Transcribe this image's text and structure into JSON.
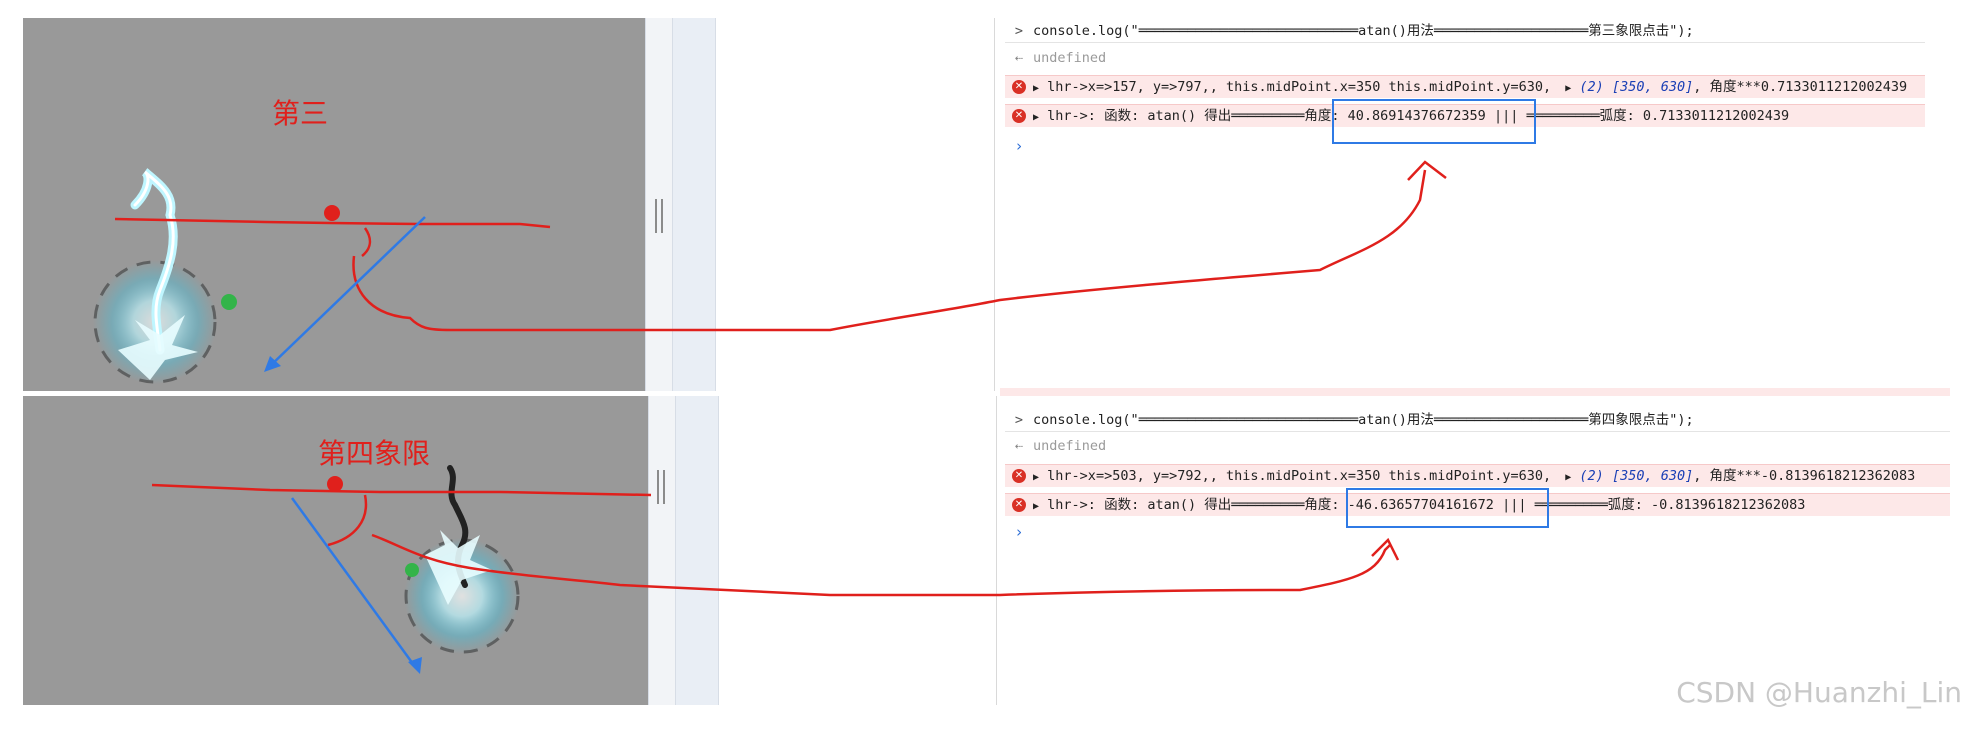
{
  "panel_top": {
    "quadrant_label": "第三",
    "console": {
      "command": "console.log(\"═══════════════════════════atan()用法═══════════════════第三象限点击\");",
      "result": "undefined",
      "log1": {
        "prefix": "lhr->x=>157, y=>797,, this.midPoint.x=350 this.midPoint.y=630,",
        "array_count": "(2)",
        "array_values": "[350, 630]",
        "suffix": ", 角度***0.7133011212002439"
      },
      "log2": {
        "prefix": "lhr->: 函数: atan() 得出═════════",
        "angle": "角度: 40.86914376672359",
        "middle": " ||| ═════════",
        "radian": "弧度: 0.7133011212002439"
      }
    }
  },
  "panel_bottom": {
    "quadrant_label": "第四象限",
    "console": {
      "command": "console.log(\"═══════════════════════════atan()用法═══════════════════第四象限点击\");",
      "result": "undefined",
      "log1": {
        "prefix": "lhr->x=>503, y=>792,, this.midPoint.x=350 this.midPoint.y=630,",
        "array_count": "(2)",
        "array_values": "[350, 630]",
        "suffix": ", 角度***-0.8139618212362083"
      },
      "log2": {
        "prefix": "lhr->: 函数: atan() 得出═════════",
        "angle": "角度: -46.63657704161672",
        "middle": " ||| ═════════",
        "radian": "弧度: -0.8139618212362083"
      }
    }
  },
  "watermark": "CSDN @Huanzhi_Lin",
  "icons": {
    "error": "error-icon",
    "expand": "expand-triangle-icon",
    "prompt": "prompt-chevron-icon",
    "result": "return-arrow-icon"
  },
  "colors": {
    "annotation_red": "#e0201c",
    "annotation_blue": "#2f7ae5",
    "game_bg": "#999999",
    "error_row_bg": "#fde8e8"
  }
}
